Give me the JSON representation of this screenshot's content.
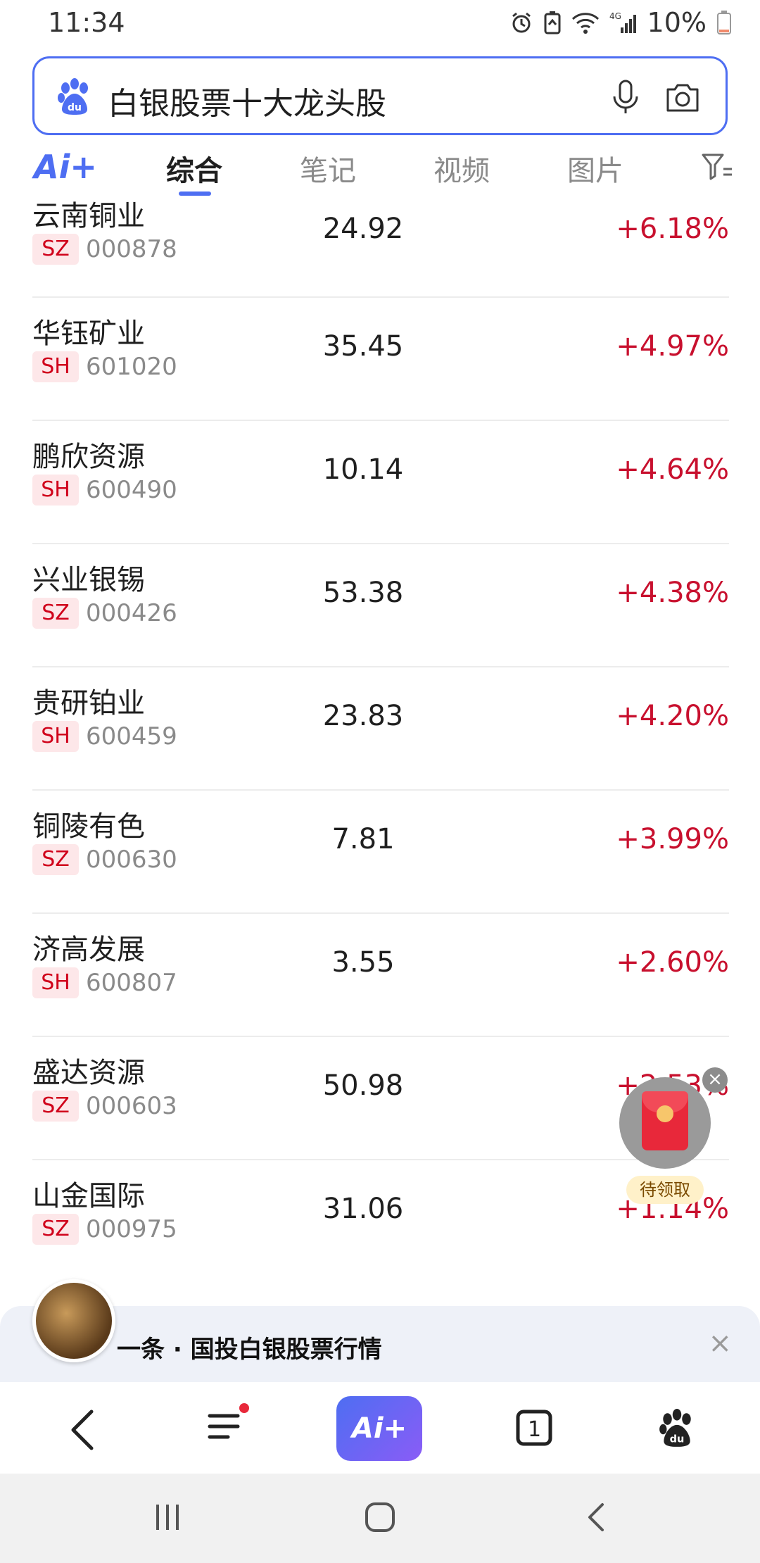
{
  "status_bar": {
    "time": "11:34",
    "network": "4G",
    "battery": "10%"
  },
  "search": {
    "query": "白银股票十大龙头股"
  },
  "tabs": {
    "ai_label": "Ai+",
    "items": [
      "综合",
      "笔记",
      "视频",
      "图片"
    ],
    "active": "综合"
  },
  "stocks": [
    {
      "name": "云南铜业",
      "market": "SZ",
      "code": "000878",
      "price": "24.92",
      "change": "+6.18%"
    },
    {
      "name": "华钰矿业",
      "market": "SH",
      "code": "601020",
      "price": "35.45",
      "change": "+4.97%"
    },
    {
      "name": "鹏欣资源",
      "market": "SH",
      "code": "600490",
      "price": "10.14",
      "change": "+4.64%"
    },
    {
      "name": "兴业银锡",
      "market": "SZ",
      "code": "000426",
      "price": "53.38",
      "change": "+4.38%"
    },
    {
      "name": "贵研铂业",
      "market": "SH",
      "code": "600459",
      "price": "23.83",
      "change": "+4.20%"
    },
    {
      "name": "铜陵有色",
      "market": "SZ",
      "code": "000630",
      "price": "7.81",
      "change": "+3.99%"
    },
    {
      "name": "济高发展",
      "market": "SH",
      "code": "600807",
      "price": "3.55",
      "change": "+2.60%"
    },
    {
      "name": "盛达资源",
      "market": "SZ",
      "code": "000603",
      "price": "50.98",
      "change": "+2.53%"
    },
    {
      "name": "山金国际",
      "market": "SZ",
      "code": "000975",
      "price": "31.06",
      "change": "+1.14%"
    }
  ],
  "red_envelope": {
    "label": "待领取",
    "close": "×"
  },
  "news": {
    "text": "一条 · 国投白银股票行情",
    "close": "×"
  },
  "bottom_nav": {
    "ai_label": "Ai+",
    "tab_count": "1"
  },
  "colors": {
    "accent": "#4e6ef2",
    "up_red": "#c8102e",
    "badge_bg": "#fde7e9"
  }
}
